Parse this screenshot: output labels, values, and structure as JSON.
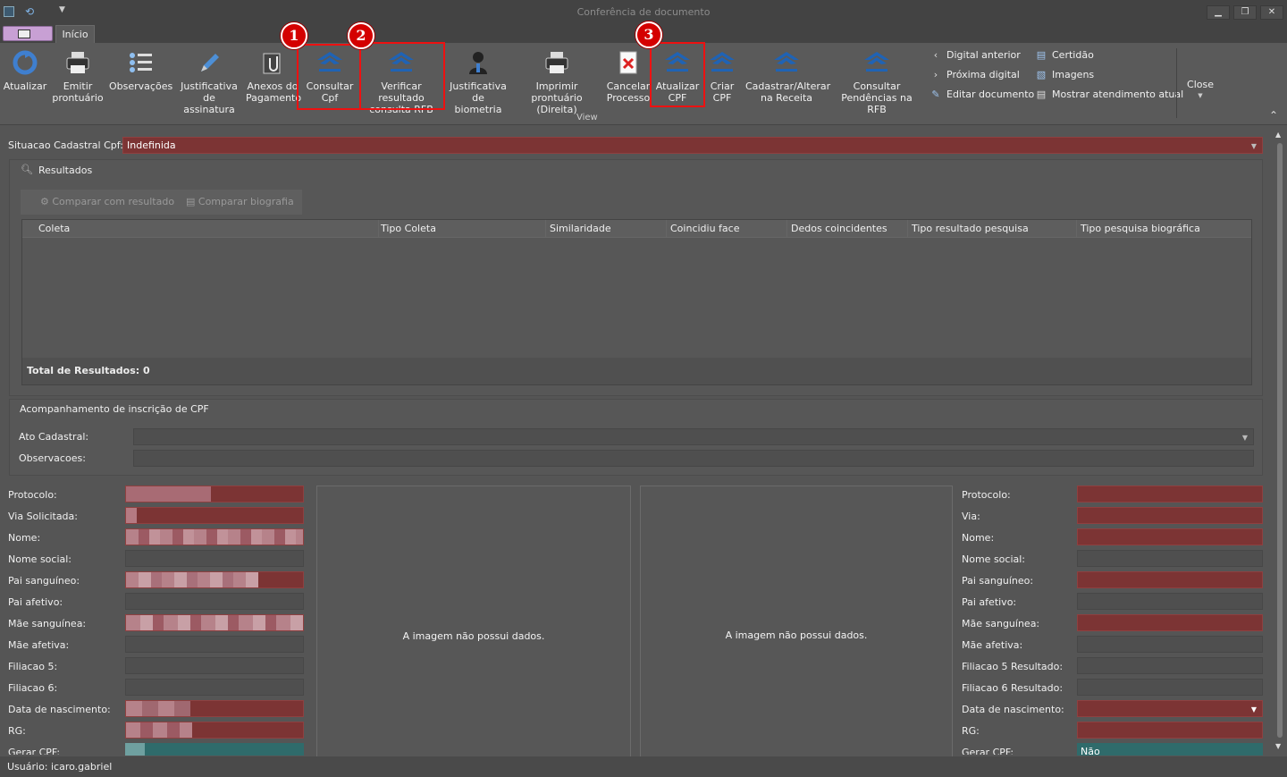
{
  "window": {
    "title": "Conferência de documento",
    "minimize": "▁",
    "restore": "❐",
    "close": "✕"
  },
  "tabs": {
    "home": "Início"
  },
  "ribbon": {
    "buttons": [
      {
        "label": "Atualizar"
      },
      {
        "label": "Emitir\nprontuário"
      },
      {
        "label": "Observações"
      },
      {
        "label": "Justificativa\nde assinatura"
      },
      {
        "label": "Anexos do\nPagamento"
      },
      {
        "label": "Consultar\nCpf"
      },
      {
        "label": "Verificar resultado\nconsulta RFB"
      },
      {
        "label": "Justificativa\nde biometria"
      },
      {
        "label": "Imprimir prontuário\n(Direita)"
      },
      {
        "label": "Cancelar\nProcesso"
      },
      {
        "label": "Atualizar\nCPF"
      },
      {
        "label": "Criar\nCPF"
      },
      {
        "label": "Cadastrar/Alterar\nna Receita"
      },
      {
        "label": "Consultar\nPendências na RFB"
      }
    ],
    "small": [
      {
        "label": "Digital anterior"
      },
      {
        "label": "Próxima digital"
      },
      {
        "label": "Editar documento"
      },
      {
        "label": "Certidão"
      },
      {
        "label": "Imagens"
      },
      {
        "label": "Mostrar atendimento atual"
      }
    ],
    "group_label": "View",
    "close_label": "Close",
    "badges": [
      "1",
      "2",
      "3"
    ]
  },
  "situacao": {
    "label": "Situacao Cadastral Cpf:",
    "value": "Indefinida"
  },
  "resultados": {
    "title": "Resultados",
    "compare_result": "Comparar com resultado",
    "compare_bio": "Comparar biografia",
    "columns": [
      "Coleta",
      "Tipo Coleta",
      "Similaridade",
      "Coincidiu face",
      "Dedos coincidentes",
      "Tipo resultado pesquisa",
      "Tipo pesquisa biográfica"
    ],
    "total": "Total de Resultados: 0"
  },
  "acompanhamento": {
    "title": "Acompanhamento de inscrição de CPF",
    "ato_label": "Ato Cadastral:",
    "obs_label": "Observacoes:"
  },
  "left_fields": [
    "Protocolo:",
    "Via Solicitada:",
    "Nome:",
    "Nome social:",
    "Pai sanguíneo:",
    "Pai afetivo:",
    "Mãe sanguínea:",
    "Mãe afetiva:",
    "Filiacao 5:",
    "Filiacao 6:",
    "Data de nascimento:",
    "RG:",
    "Gerar CPF:"
  ],
  "right_fields": [
    "Protocolo:",
    "Via:",
    "Nome:",
    "Nome social:",
    "Pai sanguíneo:",
    "Pai afetivo:",
    "Mãe sanguínea:",
    "Mãe afetiva:",
    "Filiacao 5 Resultado:",
    "Filiacao 6 Resultado:",
    "Data de nascimento:",
    "RG:",
    "Gerar CPF:"
  ],
  "right_gerar_value": "Não",
  "image_panels": {
    "left": "A imagem não possui dados.",
    "right": "A imagem não possui dados."
  },
  "status": {
    "user": "Usuário: icaro.gabriel"
  },
  "colors": {
    "accent_red": "#e11111",
    "field_red": "#7c3434",
    "teal": "#2f6b6b"
  }
}
